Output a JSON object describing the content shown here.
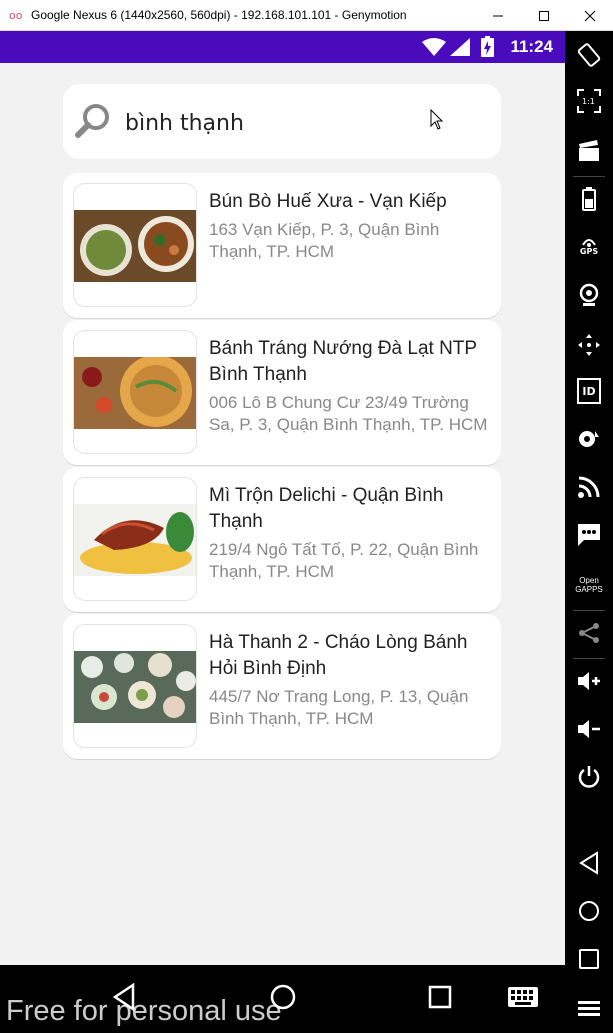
{
  "window": {
    "title": "Google Nexus 6 (1440x2560, 560dpi) - 192.168.101.101 - Genymotion",
    "logo_text": "oo"
  },
  "statusbar": {
    "time": "11:24",
    "bg_color": "#4a0bbd"
  },
  "search": {
    "query": "bình thạnh"
  },
  "results": [
    {
      "name": "Bún Bò Huế Xưa - Vạn Kiếp",
      "address": "163 Vạn Kiếp, P. 3,  Quận Bình Thạnh, TP. HCM"
    },
    {
      "name": "Bánh Tráng Nướng Đà Lạt NTP Bình Thạnh",
      "address": "006 Lô B Chung Cư 23/49 Trường Sa, P. 3,  Quận Bình Thạnh, TP. HCM"
    },
    {
      "name": "Mì Trộn Delichi - Quận Bình Thạnh",
      "address": "219/4 Ngô Tất Tố, P. 22,  Quận Bình Thạnh, TP. HCM"
    },
    {
      "name": "Hà Thanh 2 - Cháo Lòng Bánh Hỏi Bình Định",
      "address": "445/7 Nơ Trang Long, P. 13, Quận Bình Thạnh, TP. HCM"
    }
  ],
  "sidebar": {
    "gps_label": "GPS",
    "id_label": "ID",
    "opengapps_line1": "Open",
    "opengapps_line2": "GAPPS"
  },
  "watermark": "Free for personal use"
}
